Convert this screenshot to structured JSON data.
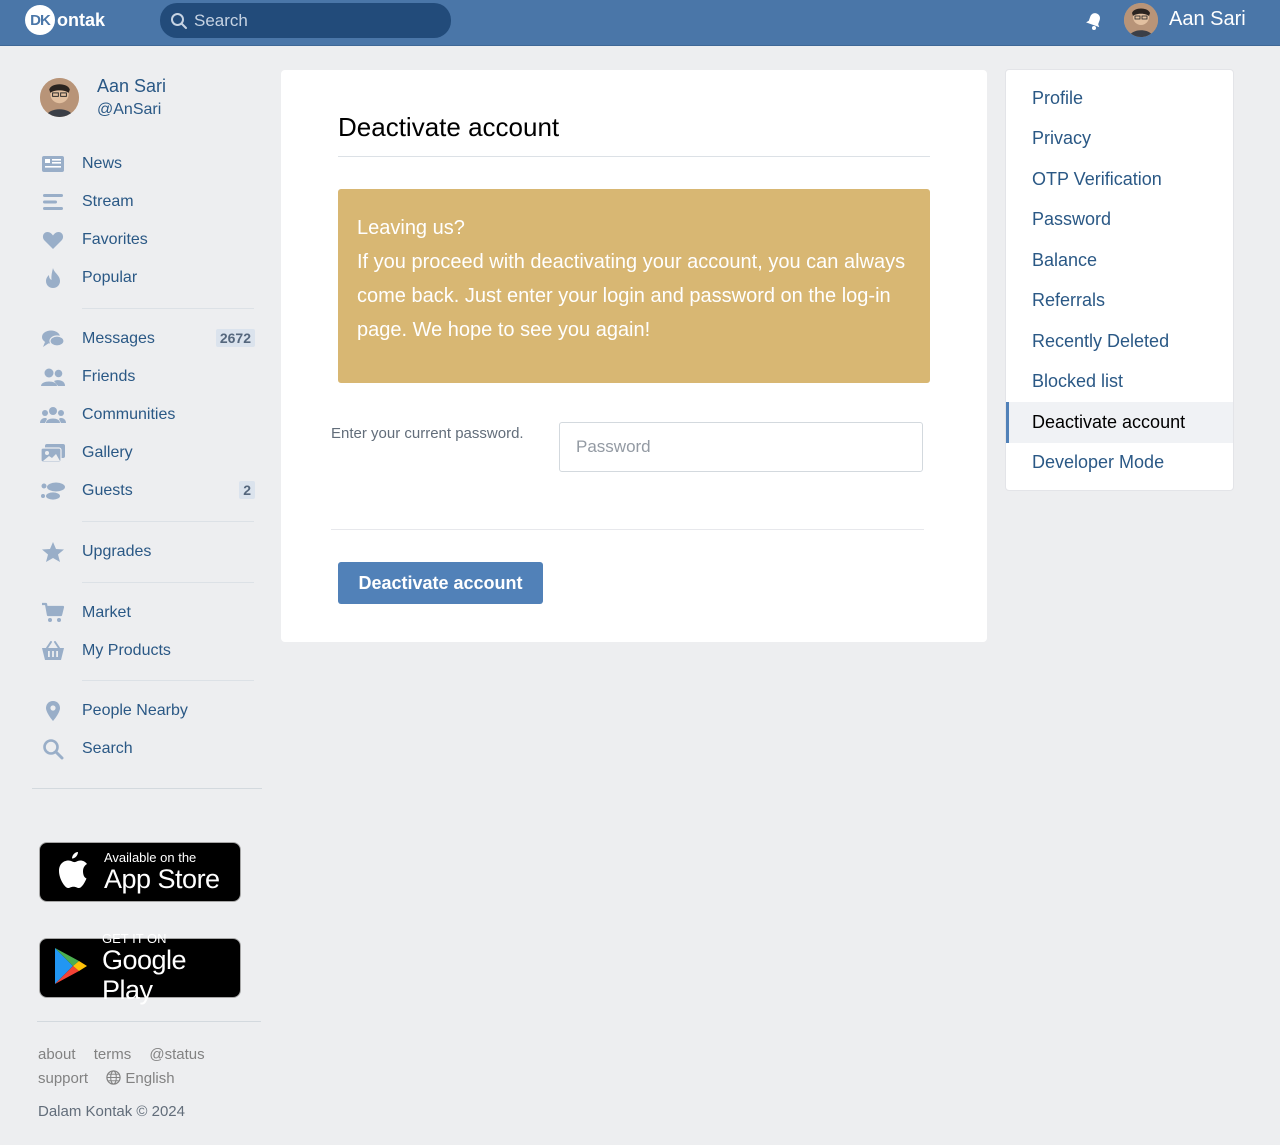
{
  "header": {
    "logo_badge": "DK",
    "logo_text": "ontak",
    "search_placeholder": "Search",
    "user_name": "Aan Sari"
  },
  "profile": {
    "name": "Aan Sari",
    "handle": "@AnSari"
  },
  "nav": {
    "news": "News",
    "stream": "Stream",
    "favorites": "Favorites",
    "popular": "Popular",
    "messages": "Messages",
    "messages_count": "2672",
    "friends": "Friends",
    "communities": "Communities",
    "gallery": "Gallery",
    "guests": "Guests",
    "guests_count": "2",
    "upgrades": "Upgrades",
    "market": "Market",
    "my_products": "My Products",
    "people_nearby": "People Nearby",
    "search": "Search"
  },
  "stores": {
    "apple_line1": "Available on the",
    "apple_line2": "App Store",
    "google_line1": "GET IT ON",
    "google_line2": "Google Play"
  },
  "footer": {
    "about": "about",
    "terms": "terms",
    "status": "@status",
    "support": "support",
    "language": "English",
    "copyright": "Dalam Kontak © 2024"
  },
  "main": {
    "title": "Deactivate account",
    "notice_line1": "Leaving us?",
    "notice_body": "If you proceed with deactivating your account, you can always come back. Just enter your login and password on the log-in page. We hope to see you again!",
    "password_label": "Enter your current password.",
    "password_placeholder": "Password",
    "submit_label": "Deactivate account"
  },
  "settings_menu": [
    {
      "label": "Profile"
    },
    {
      "label": "Privacy"
    },
    {
      "label": "OTP Verification"
    },
    {
      "label": "Password"
    },
    {
      "label": "Balance"
    },
    {
      "label": "Referrals"
    },
    {
      "label": "Recently Deleted"
    },
    {
      "label": "Blocked list"
    },
    {
      "label": "Deactivate account",
      "active": true
    },
    {
      "label": "Developer Mode"
    }
  ],
  "colors": {
    "header_bg": "#4a76a8",
    "accent": "#5181b8",
    "link": "#2a5885",
    "notice_bg": "#d8b773",
    "page_bg": "#edeef0"
  }
}
